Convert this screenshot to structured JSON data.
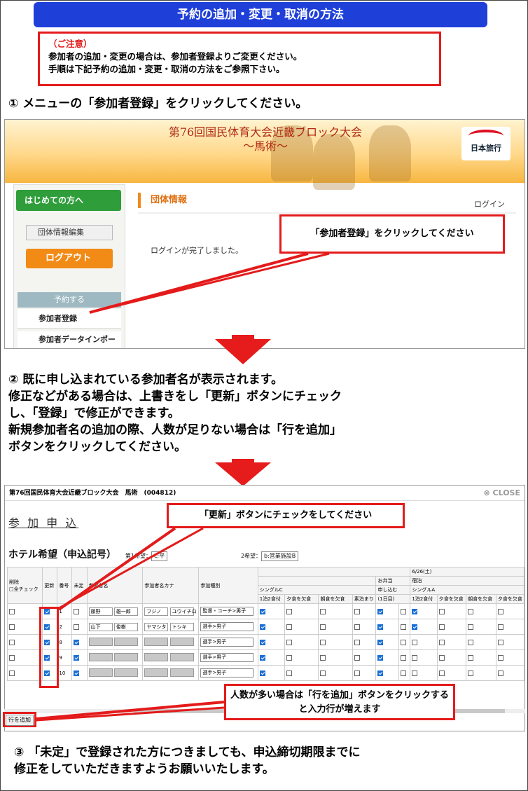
{
  "header": {
    "title": "予約の追加・変更・取消の方法"
  },
  "notice": {
    "title": "（ご注意）",
    "line1": "参加者の追加・変更の場合は、参加者登録よりご変更ください。",
    "line2": "手順は下記予約の追加・変更・取消の方法をご参照下さい。"
  },
  "steps": {
    "step1": "①  メニューの「参加者登録」をクリックしてください。",
    "step2": "②  既に申し込まれている参加者名が表示されます。\n     修正などがある場合は、上書きをし「更新」ボタンにチェック\n     し、「登録」で修正ができます。\n     新規参加者名の追加の際、人数が足りない場合は「行を追加」\n     ボタンをクリックしてください。",
    "step3": "③  「未定」で登録された方につきましても、申込締切期限までに\n     修正をしていただきますようお願いいたします。"
  },
  "screen1": {
    "banner_title": "第76回国民体育大会近畿ブロック大会",
    "banner_sub": "～馬術～",
    "logo_text": "日本旅行",
    "sidebar": {
      "first_time": "はじめての方へ",
      "edit_group": "団体情報編集",
      "logout": "ログアウト",
      "reserve": "予約する",
      "participant_register": "参加者登録",
      "data_import": "参加者データインポート"
    },
    "section_title": "団体情報",
    "login_link": "ログイン",
    "login_done": "ログインが完了しました。",
    "callout": "「参加者登録」をクリックしてください"
  },
  "screen2": {
    "top_title": "第76回国民体育大会近畿ブロック大会　馬術　(004812)",
    "close": "CLOSE",
    "apply_title": "参 加 申 込",
    "hotel_title": "ホテル希望（申込記号）",
    "pref1_label": "第1希望：",
    "pref1_value": "c:平",
    "pref2_label": "2希望：",
    "pref2_value": "b:営業施設B",
    "callout_update": "「更新」ボタンにチェックをしてください",
    "callout_add": "人数が多い場合は「行を追加」ボタンをクリックすると入力行が増えます",
    "add_row_button": "行を追加",
    "headers": {
      "delete": "削除",
      "check_all": "□全チェック",
      "update": "更新",
      "number": "番号",
      "undecided": "未定",
      "name": "参加者名",
      "kana": "参加者名カナ",
      "type": "参加種別",
      "date": "6/26(土)",
      "lunch": "お弁当",
      "stay": "宿泊",
      "single_c": "シングルC",
      "apply": "申し込む",
      "single_a": "シングルA",
      "meal1": "1泊2食付",
      "no_dinner": "夕食を欠食",
      "no_breakfast": "朝食を欠食",
      "room_only": "素泊まり",
      "one_day": "(1日目)"
    },
    "rows": [
      {
        "no": "1",
        "undecided": false,
        "last": "藤野",
        "first": "雄一郎",
        "kana_last": "フジノ",
        "kana_first": "ユウイチロ",
        "type": "監督・コーチ>男子"
      },
      {
        "no": "2",
        "undecided": false,
        "last": "山下",
        "first": "俊樹",
        "kana_last": "ヤマシタ",
        "kana_first": "トシキ",
        "type": "選手>男子"
      },
      {
        "no": "8",
        "undecided": true,
        "last": "",
        "first": "",
        "kana_last": "",
        "kana_first": "",
        "type": "選手>男子"
      },
      {
        "no": "9",
        "undecided": true,
        "last": "",
        "first": "",
        "kana_last": "",
        "kana_first": "",
        "type": "選手>男子"
      },
      {
        "no": "10",
        "undecided": true,
        "last": "",
        "first": "",
        "kana_last": "",
        "kana_first": "",
        "type": "選手>男子"
      }
    ]
  },
  "colors": {
    "accent_blue": "#1f3fd9",
    "callout_red": "#e41b1b",
    "sidebar_green": "#2e9d3a",
    "logout_orange": "#f28a16"
  }
}
